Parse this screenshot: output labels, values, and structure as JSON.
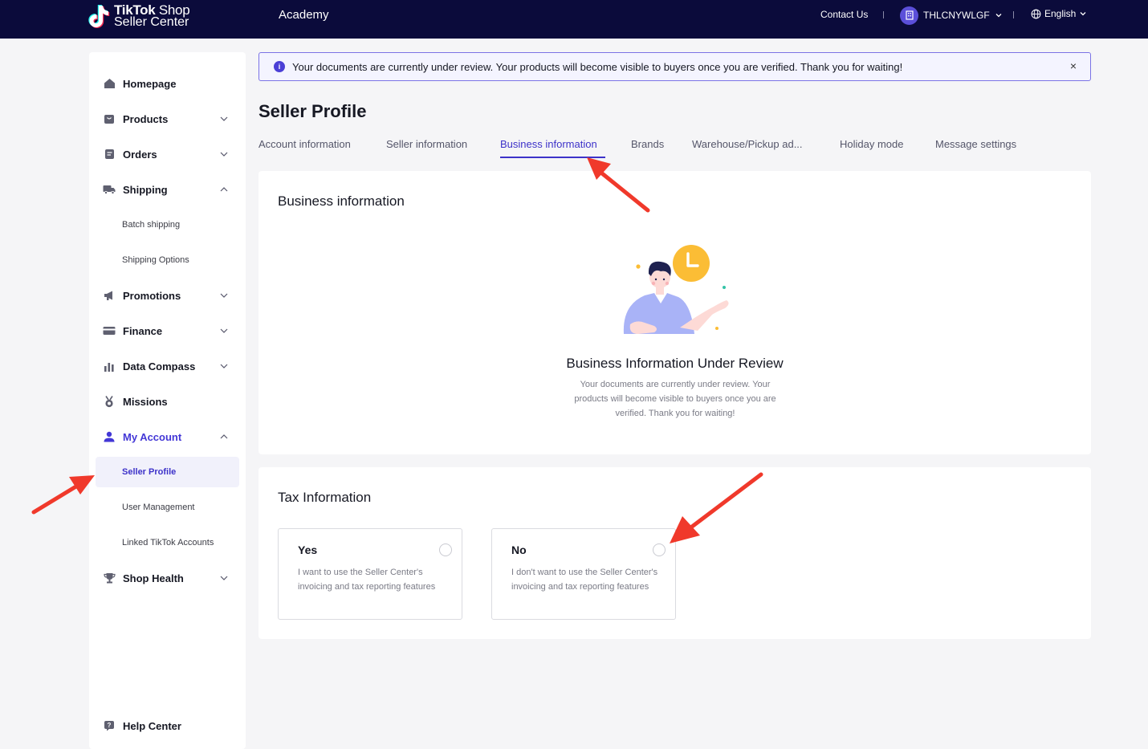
{
  "header": {
    "logo_line1_bold": "TikTok",
    "logo_line1_rest": " Shop",
    "logo_line2": "Seller Center",
    "academy": "Academy",
    "contact": "Contact Us",
    "user_name": "THLCNYWLGF",
    "language": "English",
    "accent": "#0b0b3b"
  },
  "sidebar": {
    "homepage": "Homepage",
    "products": "Products",
    "orders": "Orders",
    "shipping": "Shipping",
    "batch_shipping": "Batch shipping",
    "shipping_options": "Shipping Options",
    "promotions": "Promotions",
    "finance": "Finance",
    "data_compass": "Data Compass",
    "missions": "Missions",
    "my_account": "My Account",
    "seller_profile": "Seller Profile",
    "user_management": "User Management",
    "linked_accounts": "Linked TikTok Accounts",
    "shop_health": "Shop Health",
    "help_center": "Help Center"
  },
  "banner": {
    "message": "Your documents are currently under review. Your products will become visible to buyers once you are verified. Thank you for waiting!",
    "close": "×"
  },
  "page": {
    "title": "Seller Profile",
    "tabs": [
      "Account information",
      "Seller information",
      "Business information",
      "Brands",
      "Warehouse/Pickup ad...",
      "Holiday mode",
      "Message settings"
    ]
  },
  "business": {
    "title": "Business information",
    "review_title": "Business Information Under Review",
    "review_desc": "Your documents are currently under review. Your products will become visible to buyers once you are verified. Thank you for waiting!"
  },
  "tax": {
    "title": "Tax Information",
    "yes_title": "Yes",
    "yes_desc": "I want to use the Seller Center's invoicing and tax reporting features",
    "no_title": "No",
    "no_desc": "I don't want to use the Seller Center's invoicing and tax reporting features"
  },
  "colors": {
    "primary": "#3d32c9",
    "arrow": "#f0392b"
  }
}
